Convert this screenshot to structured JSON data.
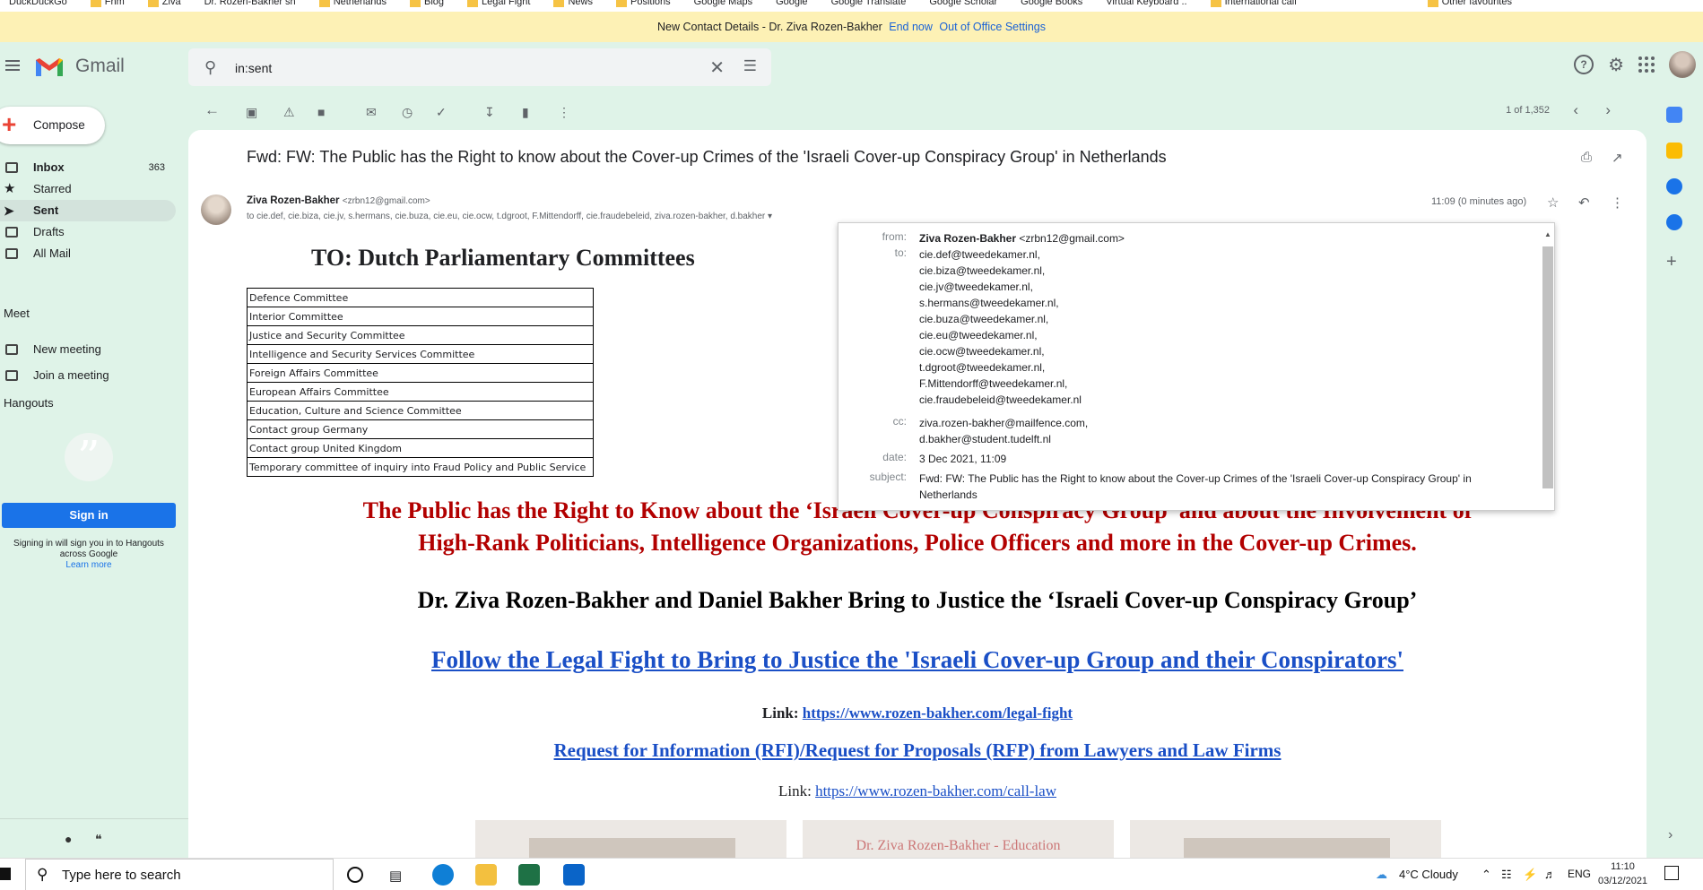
{
  "bookmarks": [
    "DuckDuckGo",
    "Fhm",
    "Ziva",
    "Dr. Rozen-Bakher sh",
    "Netherlands",
    "Blog",
    "Legal Fight",
    "News",
    "Positions",
    "Google Maps",
    "Google",
    "Google Translate",
    "Google Scholar",
    "Google Books",
    "Virtual Keyboard ..",
    "International call",
    "Other favourites"
  ],
  "banner": {
    "text": "New Contact Details - Dr. Ziva Rozen-Bakher",
    "end_now": "End now",
    "settings": "Out of Office Settings"
  },
  "header": {
    "app_name": "Gmail",
    "search_value": "in:sent"
  },
  "sidebar": {
    "compose": "Compose",
    "items": [
      {
        "label": "Inbox",
        "count": "363"
      },
      {
        "label": "Starred",
        "count": ""
      },
      {
        "label": "Sent",
        "count": ""
      },
      {
        "label": "Drafts",
        "count": ""
      },
      {
        "label": "All Mail",
        "count": ""
      }
    ],
    "meet_title": "Meet",
    "meet_items": [
      "New meeting",
      "Join a meeting"
    ],
    "hangouts_title": "Hangouts",
    "sign_in": "Sign in",
    "sign_in_note": "Signing in will sign you in to Hangouts across Google",
    "learn_more": "Learn more"
  },
  "toolbar": {
    "pager": "1 of 1,352"
  },
  "message": {
    "subject": "Fwd: FW: The Public has the Right to know about the Cover-up Crimes of the 'Israeli Cover-up Conspiracy Group' in Netherlands",
    "sender_name": "Ziva Rozen-Bakher",
    "sender_email": "<zrbn12@gmail.com>",
    "recipients_line": "to cie.def, cie.biza, cie.jv, s.hermans, cie.buza, cie.eu, cie.ocw, t.dgroot, F.Mittendorff, cie.fraudebeleid, ziva.rozen-bakher, d.bakher",
    "time": "11:09 (0 minutes ago)"
  },
  "body": {
    "to_heading": "TO:  Dutch Parliamentary Committees",
    "committees": [
      "Defence Committee",
      "Interior Committee",
      "Justice and Security Committee",
      "Intelligence and Security Services Committee",
      "Foreign Affairs Committee",
      "European Affairs Committee",
      "Education, Culture and Science Committee",
      "Contact group Germany",
      "Contact group United Kingdom",
      "Temporary committee of inquiry into Fraud Policy and Public Service"
    ],
    "red_line1": "The Public has the Right to Know about the ‘Israeli Cover-up Conspiracy Group’ and about the Involvement of",
    "red_line2": "High-Rank Politicians, Intelligence Organizations, Police Officers and more in the Cover-up Crimes.",
    "black_line": "Dr. Ziva Rozen-Bakher and Daniel Bakher Bring to Justice the ‘Israeli Cover-up Conspiracy Group’",
    "follow_link": "Follow the Legal Fight to Bring to Justice the 'Israeli Cover-up Group and their Conspirators'",
    "link1_label": "Link:",
    "link1_url": "https://www.rozen-bakher.com/legal-fight",
    "rfi_link": " Request for Information (RFI)/Request for Proposals (RFP) from Lawyers and Law Firms",
    "link2_label": "Link:",
    "link2_url": "https://www.rozen-bakher.com/call-law",
    "thumb_caption": "Dr. Ziva Rozen-Bakher - Education"
  },
  "details_popup": {
    "from_label": "from:",
    "from_name": "Ziva Rozen-Bakher",
    "from_email": "<zrbn12@gmail.com>",
    "to_label": "to:",
    "to": [
      "cie.def@tweedekamer.nl,",
      "cie.biza@tweedekamer.nl,",
      "cie.jv@tweedekamer.nl,",
      "s.hermans@tweedekamer.nl,",
      "cie.buza@tweedekamer.nl,",
      "cie.eu@tweedekamer.nl,",
      "cie.ocw@tweedekamer.nl,",
      "t.dgroot@tweedekamer.nl,",
      "F.Mittendorff@tweedekamer.nl,",
      "cie.fraudebeleid@tweedekamer.nl"
    ],
    "cc_label": "cc:",
    "cc": [
      "ziva.rozen-bakher@mailfence.com,",
      "d.bakher@student.tudelft.nl"
    ],
    "date_label": "date:",
    "date": "3 Dec 2021, 11:09",
    "subject_label": "subject:",
    "subject_line1": "Fwd: FW: The Public has the Right to know about the Cover-up Crimes of the 'Israeli Cover-up Conspiracy Group' in",
    "subject_line2": "Netherlands"
  },
  "taskbar": {
    "search_placeholder": "Type here to search",
    "weather": "4°C  Cloudy",
    "lang": "ENG",
    "time": "11:10",
    "date": "03/12/2021"
  }
}
